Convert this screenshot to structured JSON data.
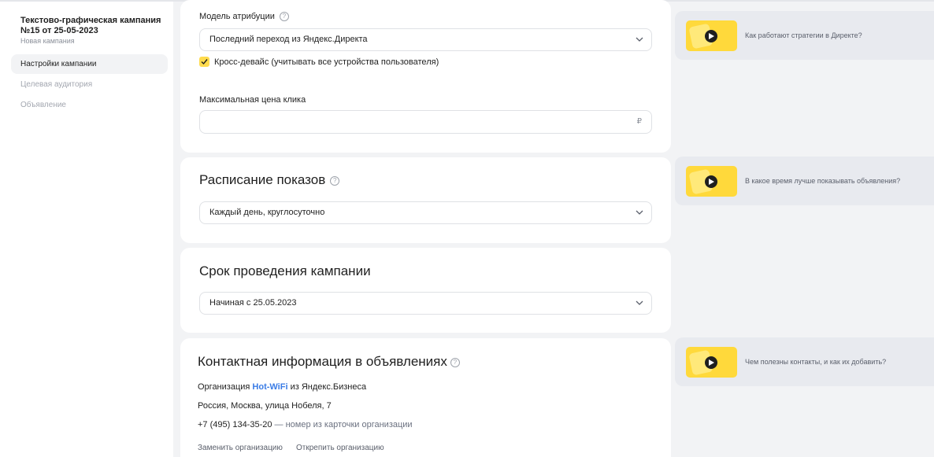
{
  "sidebar": {
    "campaign_title": "Текстово-графическая кампания №15 от 25-05-2023",
    "campaign_subtitle": "Новая кампания",
    "items": [
      {
        "label": "Настройки кампании",
        "active": true
      },
      {
        "label": "Целевая аудитория",
        "active": false
      },
      {
        "label": "Объявление",
        "active": false
      }
    ]
  },
  "attribution": {
    "label": "Модель атрибуции",
    "selected": "Последний переход из Яндекс.Директа",
    "crossdevice_label": "Кросс-девайс (учитывать все устройства пользователя)",
    "crossdevice_checked": true,
    "max_click_label": "Максимальная цена клика",
    "max_click_value": "",
    "currency": "₽"
  },
  "schedule": {
    "title": "Расписание показов",
    "selected": "Каждый день, круглосуточно"
  },
  "period": {
    "title": "Срок проведения кампании",
    "selected": "Начиная с 25.05.2023"
  },
  "contacts": {
    "title": "Контактная информация в объявлениях",
    "org_prefix": "Организация",
    "org_name": "Hot-WiFi",
    "org_suffix": "из Яндекс.Бизнеса",
    "address": "Россия, Москва, улица Нобеля, 7",
    "phone": "+7 (495) 134-35-20",
    "phone_note": "— номер из карточки организации",
    "change_org": "Заменить организацию",
    "detach_org": "Открепить организацию"
  },
  "promos": [
    {
      "text": "Как работают стратегии в Директе?"
    },
    {
      "text": "В какое время лучше показывать объявления?"
    },
    {
      "text": "Чем полезны контакты, и как их добавить?"
    }
  ],
  "icons": {
    "help": "question-circle-icon",
    "chevron": "chevron-down-icon",
    "check": "check-icon",
    "play": "play-icon"
  },
  "colors": {
    "accent_yellow": "#ffdb4d",
    "link_blue": "#3a7ce6",
    "background": "#f2f3f5"
  }
}
